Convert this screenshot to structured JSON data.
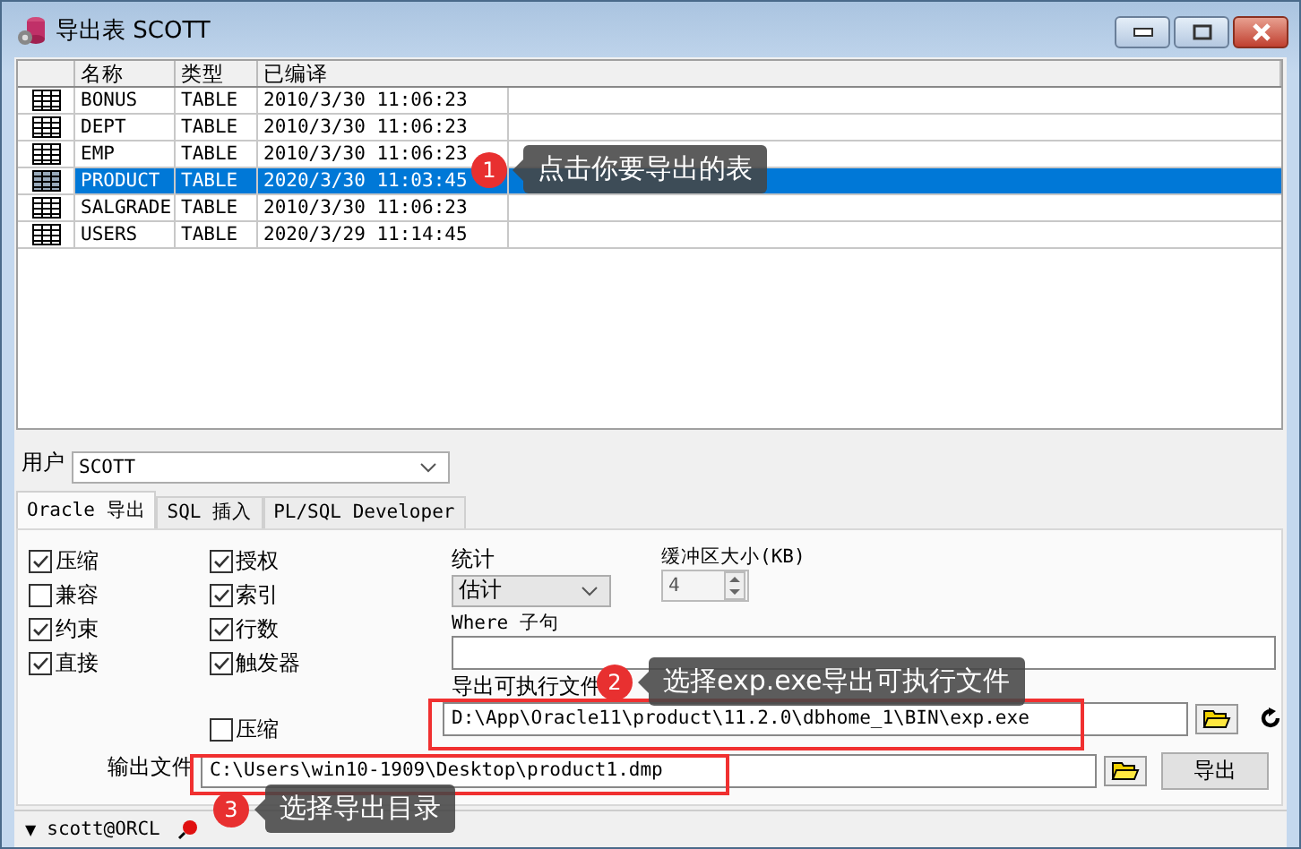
{
  "window": {
    "title": "导出表 SCOTT"
  },
  "table": {
    "columns": [
      "名称",
      "类型",
      "已编译"
    ],
    "rows": [
      {
        "name": "BONUS",
        "type": "TABLE",
        "compiled": "2010/3/30 11:06:23",
        "selected": false
      },
      {
        "name": "DEPT",
        "type": "TABLE",
        "compiled": "2010/3/30 11:06:23",
        "selected": false
      },
      {
        "name": "EMP",
        "type": "TABLE",
        "compiled": "2010/3/30 11:06:23",
        "selected": false
      },
      {
        "name": "PRODUCT",
        "type": "TABLE",
        "compiled": "2020/3/30 11:03:45",
        "selected": true
      },
      {
        "name": "SALGRADE",
        "type": "TABLE",
        "compiled": "2010/3/30 11:06:23",
        "selected": false
      },
      {
        "name": "USERS",
        "type": "TABLE",
        "compiled": "2020/3/29 11:14:45",
        "selected": false
      }
    ]
  },
  "user": {
    "label": "用户",
    "value": "SCOTT"
  },
  "tabs": [
    {
      "label": "Oracle 导出",
      "selected": true
    },
    {
      "label": "SQL 插入",
      "selected": false
    },
    {
      "label": "PL/SQL Developer",
      "selected": false
    }
  ],
  "checkbox_column_1": [
    {
      "label": "压缩",
      "checked": true
    },
    {
      "label": "兼容",
      "checked": false
    },
    {
      "label": "约束",
      "checked": true
    },
    {
      "label": "直接",
      "checked": true
    }
  ],
  "checkbox_column_2": [
    {
      "label": "授权",
      "checked": true
    },
    {
      "label": "索引",
      "checked": true
    },
    {
      "label": "行数",
      "checked": true
    },
    {
      "label": "触发器",
      "checked": true
    }
  ],
  "extra_checkbox": {
    "label": "压缩",
    "checked": false
  },
  "statistics": {
    "label": "统计",
    "value": "估计"
  },
  "buffer_size": {
    "label": "缓冲区大小(KB)",
    "value": "4"
  },
  "where_clause": {
    "label": "Where 子句"
  },
  "executable": {
    "label": "导出可执行文件",
    "value": "D:\\App\\Oracle11\\product\\11.2.0\\dbhome_1\\BIN\\exp.exe"
  },
  "output_file": {
    "label": "输出文件",
    "value": "C:\\Users\\win10-1909\\Desktop\\product1.dmp"
  },
  "export_button": "导出",
  "status_bar": {
    "caret": "▼",
    "connection": "scott@ORCL"
  },
  "annotations": [
    {
      "number": "1",
      "text": "点击你要导出的表"
    },
    {
      "number": "2",
      "text": "选择exp.exe导出可执行文件"
    },
    {
      "number": "3",
      "text": "选择导出目录"
    }
  ]
}
